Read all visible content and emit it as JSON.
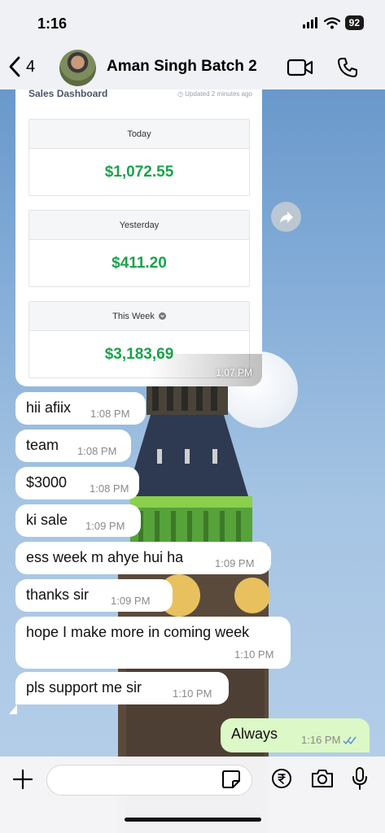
{
  "status": {
    "time": "1:16",
    "battery": "92"
  },
  "header": {
    "back_count": "4",
    "chat_title": "Aman Singh Batch 2"
  },
  "dashboard": {
    "title": "Sales Dashboard",
    "updated": "Updated 2 minutes ago",
    "cards": [
      {
        "label": "Today",
        "value": "$1,072.55"
      },
      {
        "label": "Yesterday",
        "value": "$411.20"
      },
      {
        "label": "This Week",
        "value": "$3,183,69"
      }
    ],
    "value_color": "#19a34a",
    "time": "1:07 PM"
  },
  "messages": [
    {
      "text": "hii afiix",
      "time": "1:08 PM",
      "direction": "in"
    },
    {
      "text": "team",
      "time": "1:08 PM",
      "direction": "in"
    },
    {
      "text": "$3000",
      "time": "1:08 PM",
      "direction": "in"
    },
    {
      "text": "ki sale",
      "time": "1:09 PM",
      "direction": "in"
    },
    {
      "text": "ess week m ahye hui ha",
      "time": "1:09 PM",
      "direction": "in"
    },
    {
      "text": "thanks sir",
      "time": "1:09 PM",
      "direction": "in"
    },
    {
      "text": "hope I make more in coming week",
      "time": "1:10 PM",
      "direction": "in"
    },
    {
      "text": "pls support me sir",
      "time": "1:10 PM",
      "direction": "in"
    },
    {
      "text": "Always",
      "time": "1:16 PM",
      "direction": "out",
      "read": true
    }
  ],
  "composer": {
    "value": "",
    "placeholder": ""
  },
  "colors": {
    "outgoing_bubble": "#dcf8c6",
    "incoming_bubble": "#ffffff",
    "read_ticks": "#5a8fd6"
  },
  "icons": {
    "back": "chevron-left-icon",
    "video": "video-camera-icon",
    "call": "phone-icon",
    "forward": "forward-arrow-icon",
    "attach": "plus-icon",
    "sticker": "sticker-icon",
    "payment": "rupee-icon",
    "camera": "camera-icon",
    "mic": "microphone-icon"
  }
}
